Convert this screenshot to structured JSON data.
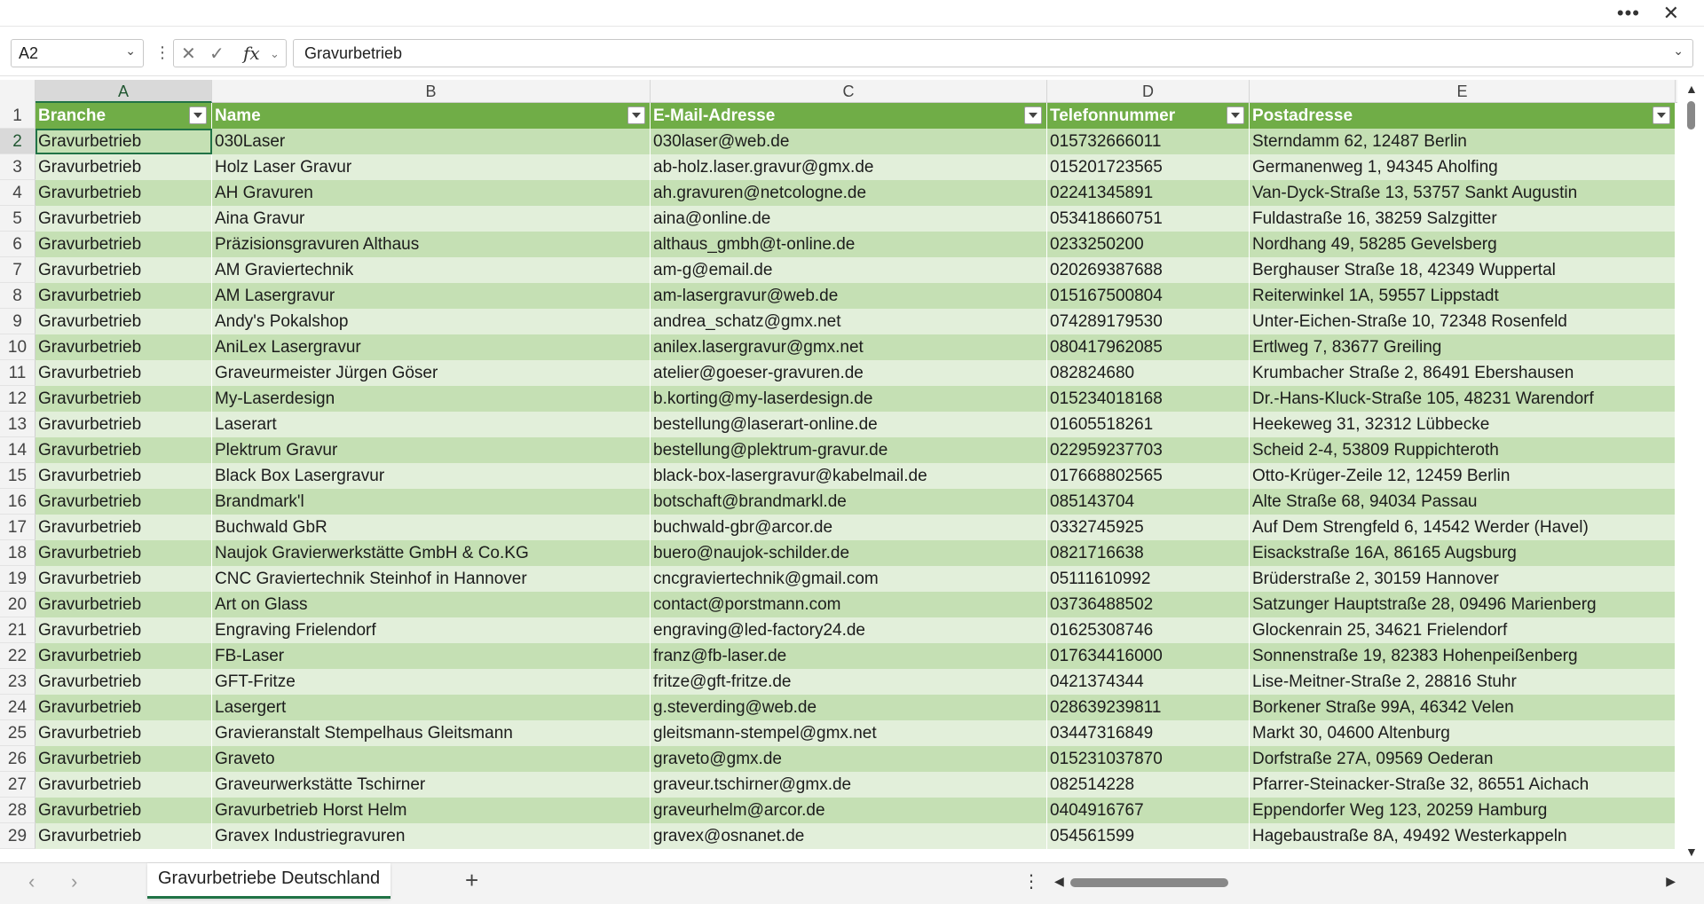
{
  "window": {
    "more_icon": "ellipsis-icon",
    "close_icon": "close-icon"
  },
  "formula_bar": {
    "name_box": "A2",
    "cancel_icon": "x-icon",
    "enter_icon": "check-icon",
    "fx_label": "fx",
    "content": "Gravurbetrieb"
  },
  "columns": [
    "A",
    "B",
    "C",
    "D",
    "E"
  ],
  "headers": [
    "Branche",
    "Name",
    "E-Mail-Adresse",
    "Telefonnummer",
    "Postadresse"
  ],
  "rows": [
    {
      "num": "2",
      "cells": [
        "Gravurbetrieb",
        "030Laser",
        "030laser@web.de",
        "015732666011",
        "Sterndamm 62, 12487 Berlin"
      ]
    },
    {
      "num": "3",
      "cells": [
        "Gravurbetrieb",
        "Holz Laser Gravur",
        "ab-holz.laser.gravur@gmx.de",
        "015201723565",
        "Germanenweg 1, 94345 Aholfing"
      ]
    },
    {
      "num": "4",
      "cells": [
        "Gravurbetrieb",
        "AH Gravuren",
        "ah.gravuren@netcologne.de",
        "02241345891",
        "Van-Dyck-Straße 13, 53757 Sankt Augustin"
      ]
    },
    {
      "num": "5",
      "cells": [
        "Gravurbetrieb",
        "Aina Gravur",
        "aina@online.de",
        "053418660751",
        "Fuldastraße 16, 38259 Salzgitter"
      ]
    },
    {
      "num": "6",
      "cells": [
        "Gravurbetrieb",
        "Präzisionsgravuren Althaus",
        "althaus_gmbh@t-online.de",
        "0233250200",
        "Nordhang 49, 58285 Gevelsberg"
      ]
    },
    {
      "num": "7",
      "cells": [
        "Gravurbetrieb",
        "AM Graviertechnik",
        "am-g@email.de",
        "020269387688",
        "Berghauser Straße 18, 42349 Wuppertal"
      ]
    },
    {
      "num": "8",
      "cells": [
        "Gravurbetrieb",
        "AM Lasergravur",
        "am-lasergravur@web.de",
        "015167500804",
        "Reiterwinkel 1A, 59557 Lippstadt"
      ]
    },
    {
      "num": "9",
      "cells": [
        "Gravurbetrieb",
        "Andy's Pokalshop",
        "andrea_schatz@gmx.net",
        "074289179530",
        "Unter-Eichen-Straße 10, 72348 Rosenfeld"
      ]
    },
    {
      "num": "10",
      "cells": [
        "Gravurbetrieb",
        "AniLex Lasergravur",
        "anilex.lasergravur@gmx.net",
        "080417962085",
        "Ertlweg 7, 83677 Greiling"
      ]
    },
    {
      "num": "11",
      "cells": [
        "Gravurbetrieb",
        "Graveurmeister Jürgen Göser",
        "atelier@goeser-gravuren.de",
        "082824680",
        "Krumbacher Straße 2, 86491 Ebershausen"
      ]
    },
    {
      "num": "12",
      "cells": [
        "Gravurbetrieb",
        "My-Laserdesign",
        "b.korting@my-laserdesign.de",
        "015234018168",
        "Dr.-Hans-Kluck-Straße 105, 48231 Warendorf"
      ]
    },
    {
      "num": "13",
      "cells": [
        "Gravurbetrieb",
        "Laserart",
        "bestellung@laserart-online.de",
        "01605518261",
        "Heekeweg 31, 32312 Lübbecke"
      ]
    },
    {
      "num": "14",
      "cells": [
        "Gravurbetrieb",
        "Plektrum Gravur",
        "bestellung@plektrum-gravur.de",
        "022959237703",
        "Scheid 2-4, 53809 Ruppichteroth"
      ]
    },
    {
      "num": "15",
      "cells": [
        "Gravurbetrieb",
        "Black Box Lasergravur",
        "black-box-lasergravur@kabelmail.de",
        "017668802565",
        "Otto-Krüger-Zeile 12, 12459 Berlin"
      ]
    },
    {
      "num": "16",
      "cells": [
        "Gravurbetrieb",
        "Brandmark'l",
        "botschaft@brandmarkl.de",
        "085143704",
        "Alte Straße 68, 94034 Passau"
      ]
    },
    {
      "num": "17",
      "cells": [
        "Gravurbetrieb",
        "Buchwald GbR",
        "buchwald-gbr@arcor.de",
        "0332745925",
        "Auf Dem Strengfeld 6, 14542 Werder (Havel)"
      ]
    },
    {
      "num": "18",
      "cells": [
        "Gravurbetrieb",
        "Naujok Gravierwerkstätte GmbH & Co.KG",
        "buero@naujok-schilder.de",
        "0821716638",
        "Eisackstraße 16A, 86165 Augsburg"
      ]
    },
    {
      "num": "19",
      "cells": [
        "Gravurbetrieb",
        "CNC Graviertechnik Steinhof in Hannover",
        "cncgraviertechnik@gmail.com",
        "05111610992",
        "Brüderstraße 2, 30159 Hannover"
      ]
    },
    {
      "num": "20",
      "cells": [
        "Gravurbetrieb",
        "Art on Glass",
        "contact@porstmann.com",
        "03736488502",
        "Satzunger Hauptstraße 28, 09496 Marienberg"
      ]
    },
    {
      "num": "21",
      "cells": [
        "Gravurbetrieb",
        "Engraving Frielendorf",
        "engraving@led-factory24.de",
        "01625308746",
        "Glockenrain 25, 34621 Frielendorf"
      ]
    },
    {
      "num": "22",
      "cells": [
        "Gravurbetrieb",
        "FB-Laser",
        "franz@fb-laser.de",
        "017634416000",
        "Sonnenstraße 19, 82383 Hohenpeißenberg"
      ]
    },
    {
      "num": "23",
      "cells": [
        "Gravurbetrieb",
        "GFT-Fritze",
        "fritze@gft-fritze.de",
        "0421374344",
        "Lise-Meitner-Straße 2, 28816 Stuhr"
      ]
    },
    {
      "num": "24",
      "cells": [
        "Gravurbetrieb",
        "Lasergert",
        "g.steverding@web.de",
        "028639239811",
        "Borkener Straße 99A, 46342 Velen"
      ]
    },
    {
      "num": "25",
      "cells": [
        "Gravurbetrieb",
        "Gravieranstalt Stempelhaus Gleitsmann",
        "gleitsmann-stempel@gmx.net",
        "03447316849",
        "Markt 30, 04600 Altenburg"
      ]
    },
    {
      "num": "26",
      "cells": [
        "Gravurbetrieb",
        "Graveto",
        "graveto@gmx.de",
        "015231037870",
        "Dorfstraße 27A, 09569 Oederan"
      ]
    },
    {
      "num": "27",
      "cells": [
        "Gravurbetrieb",
        "Graveurwerkstätte Tschirner",
        "graveur.tschirner@gmx.de",
        "082514228",
        "Pfarrer-Steinacker-Straße 32, 86551 Aichach"
      ]
    },
    {
      "num": "28",
      "cells": [
        "Gravurbetrieb",
        "Gravurbetrieb Horst Helm",
        "graveurhelm@arcor.de",
        "0404916767",
        "Eppendorfer Weg 123, 20259 Hamburg"
      ]
    },
    {
      "num": "29",
      "cells": [
        "Gravurbetrieb",
        "Gravex Industriegravuren",
        "gravex@osnanet.de",
        "054561599",
        "Hagebaustraße 8A, 49492 Westerkappeln"
      ]
    }
  ],
  "sheet_tabs": {
    "active": "Gravurbetriebe Deutschland",
    "add_label": "+"
  },
  "colors": {
    "header_bg": "#70ad47",
    "band_dark": "#c5e0b4",
    "band_light": "#e2efda",
    "accent": "#217346"
  }
}
